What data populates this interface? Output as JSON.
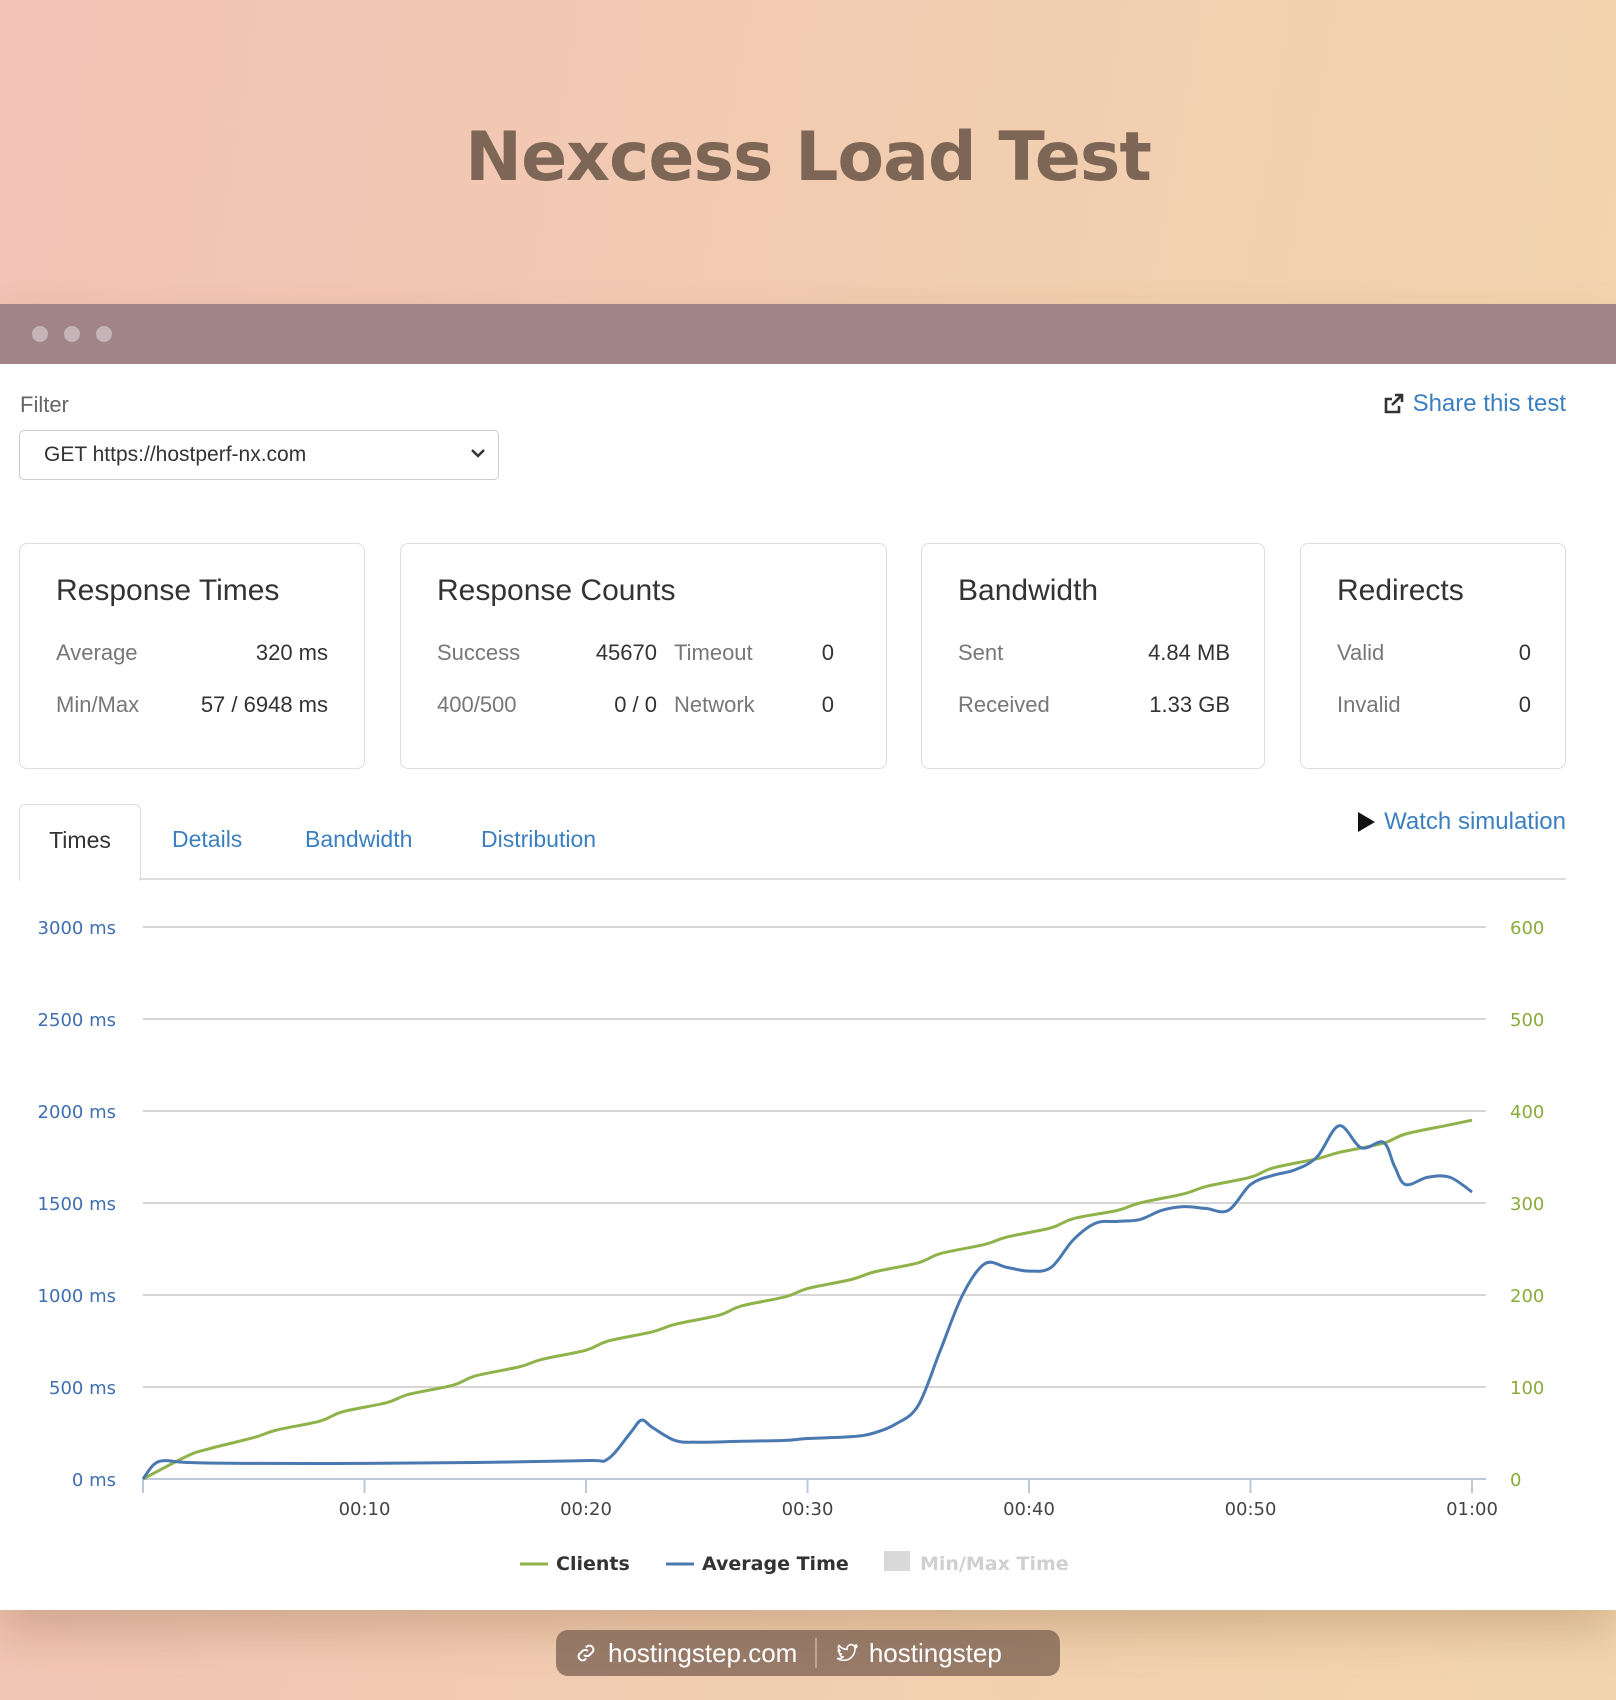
{
  "page": {
    "title": "Nexcess Load Test"
  },
  "filter": {
    "label": "Filter",
    "selected": "GET https://hostperf-nx.com"
  },
  "share": {
    "label": "Share this test"
  },
  "cards": {
    "response_times": {
      "title": "Response Times",
      "rows": [
        {
          "label": "Average",
          "value": "320 ms"
        },
        {
          "label": "Min/Max",
          "value": "57 / 6948 ms"
        }
      ]
    },
    "response_counts": {
      "title": "Response Counts",
      "rows": [
        {
          "label": "Success",
          "value": "45670",
          "label2": "Timeout",
          "value2": "0"
        },
        {
          "label": "400/500",
          "value": "0 / 0",
          "label2": "Network",
          "value2": "0"
        }
      ]
    },
    "bandwidth": {
      "title": "Bandwidth",
      "rows": [
        {
          "label": "Sent",
          "value": "4.84 MB"
        },
        {
          "label": "Received",
          "value": "1.33 GB"
        }
      ]
    },
    "redirects": {
      "title": "Redirects",
      "rows": [
        {
          "label": "Valid",
          "value": "0"
        },
        {
          "label": "Invalid",
          "value": "0"
        }
      ]
    }
  },
  "tabs": [
    {
      "label": "Times",
      "active": true
    },
    {
      "label": "Details"
    },
    {
      "label": "Bandwidth"
    },
    {
      "label": "Distribution"
    }
  ],
  "watch": {
    "label": "Watch simulation"
  },
  "colors": {
    "clients": "#8fb24a",
    "average": "#4a78b0",
    "minmax": "#d9d9d9",
    "link": "#3b7fc0"
  },
  "chart_data": {
    "type": "line",
    "x_ticks": [
      "00:10",
      "00:20",
      "00:30",
      "00:40",
      "00:50",
      "01:00"
    ],
    "y_left_ticks": [
      "0 ms",
      "500 ms",
      "1000 ms",
      "1500 ms",
      "2000 ms",
      "2500 ms",
      "3000 ms"
    ],
    "y_right_ticks": [
      "0",
      "100",
      "200",
      "300",
      "400",
      "500",
      "600"
    ],
    "ylim_left": [
      0,
      3000
    ],
    "ylim_right": [
      0,
      600
    ],
    "xlim_seconds": [
      0,
      60
    ],
    "grid": true,
    "legend_position": "bottom",
    "series": [
      {
        "name": "Clients",
        "axis": "right",
        "x": [
          0,
          2,
          3,
          5,
          6,
          8,
          9,
          11,
          12,
          14,
          15,
          17,
          18,
          20,
          21,
          23,
          24,
          26,
          27,
          29,
          30,
          32,
          33,
          35,
          36,
          38,
          39,
          41,
          42,
          44,
          45,
          47,
          48,
          50,
          51,
          53,
          54,
          56,
          57,
          59,
          60
        ],
        "y": [
          0,
          25,
          33,
          45,
          53,
          63,
          73,
          83,
          92,
          102,
          112,
          122,
          130,
          140,
          150,
          160,
          168,
          178,
          188,
          198,
          207,
          217,
          225,
          235,
          245,
          255,
          263,
          273,
          283,
          292,
          300,
          310,
          318,
          328,
          338,
          348,
          355,
          365,
          375,
          385,
          390
        ]
      },
      {
        "name": "Average Time",
        "axis": "left",
        "x": [
          0,
          0.5,
          1,
          2,
          5,
          10,
          15,
          20,
          21,
          22,
          22.5,
          23,
          24,
          25,
          27,
          29,
          30,
          32,
          33,
          34,
          35,
          36,
          37,
          38,
          39,
          40,
          41,
          42,
          43,
          44,
          45,
          46,
          47,
          48,
          49,
          50,
          51,
          52,
          53,
          54,
          55,
          56,
          56.5,
          57,
          58,
          59,
          60
        ],
        "y": [
          0,
          80,
          100,
          90,
          85,
          85,
          90,
          100,
          110,
          250,
          320,
          280,
          210,
          200,
          205,
          210,
          220,
          230,
          250,
          300,
          400,
          700,
          1000,
          1170,
          1150,
          1130,
          1150,
          1300,
          1390,
          1400,
          1410,
          1460,
          1480,
          1470,
          1460,
          1600,
          1650,
          1680,
          1750,
          1920,
          1800,
          1830,
          1700,
          1600,
          1640,
          1640,
          1560
        ]
      },
      {
        "name": "Min/Max Time",
        "axis": "left",
        "x": [],
        "y": []
      }
    ]
  },
  "footer": {
    "site": "hostingstep.com",
    "twitter": "hostingstep"
  }
}
